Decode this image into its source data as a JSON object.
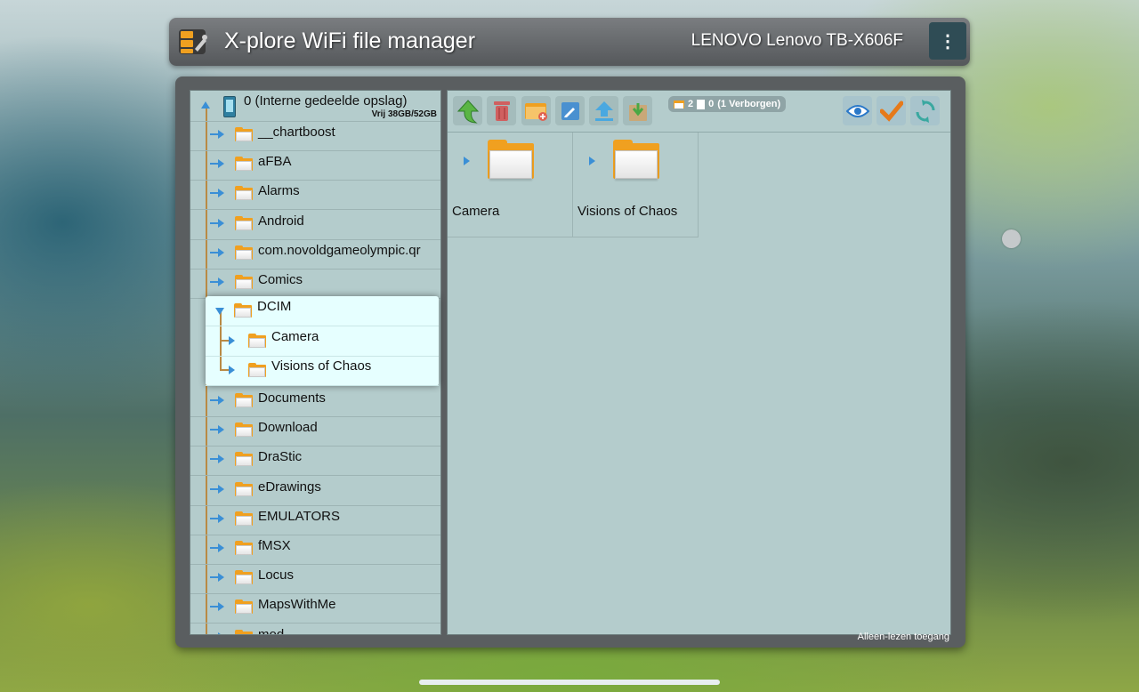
{
  "titlebar": {
    "app_title": "X-plore WiFi file manager",
    "device_name": "LENOVO Lenovo TB-X606F",
    "menu_icon": "⋮"
  },
  "tree": {
    "root_label": "0 (Interne gedeelde opslag)",
    "root_free": "Vrij 38GB/52GB",
    "items_before": [
      "__chartboost",
      "aFBA",
      "Alarms",
      "Android",
      "com.novoldgameolympic.qr",
      "Comics"
    ],
    "expanded": {
      "label": "DCIM",
      "children": [
        "Camera",
        "Visions of Chaos"
      ]
    },
    "items_after": [
      "Documents",
      "Download",
      "DraStic",
      "eDrawings",
      "EMULATORS",
      "fMSX",
      "Locus",
      "MapsWithMe",
      "mod"
    ]
  },
  "toolbar": {
    "folder_count": "2",
    "file_count": "0",
    "hidden_text": "(1 Verborgen)"
  },
  "grid": {
    "items": [
      "Camera",
      "Visions of Chaos"
    ]
  },
  "status": "Alleen-lezen toegang",
  "colors": {
    "accent": "#3a8fd6",
    "folder": "#f0a020",
    "pane_bg": "#b4cccc",
    "highlight_bg": "#e6ffff",
    "tree_line": "#b98a45"
  }
}
